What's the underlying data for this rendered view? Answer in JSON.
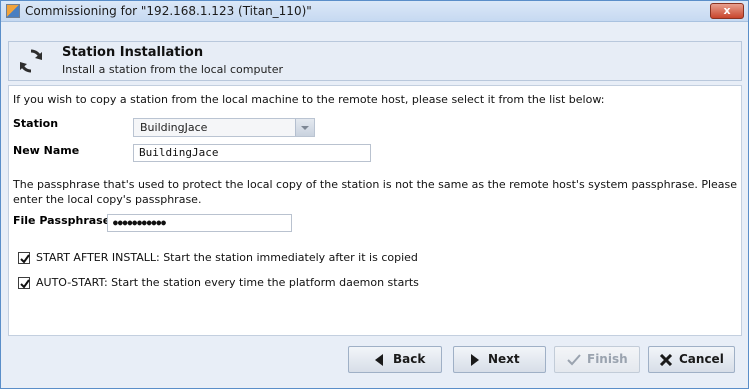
{
  "window": {
    "title": "Commissioning for \"192.168.1.123 (Titan_110)\"",
    "close_label": "x"
  },
  "header": {
    "title": "Station Installation",
    "subtitle": "Install a station from the local computer"
  },
  "form": {
    "intro": "If you wish to copy a station from the local machine to the remote host, please select it from the list below:",
    "station_label": "Station",
    "station_value": "BuildingJace",
    "new_name_label": "New Name",
    "new_name_value": "BuildingJace",
    "passphrase_note_line1": "The passphrase that's used to protect the local copy of the station is not the same as the remote host's system passphrase. Please",
    "passphrase_note_line2": "enter the local copy's passphrase.",
    "passphrase_label": "File Passphrase",
    "passphrase_value": "●●●●●●●●●●●",
    "start_after_install": {
      "checked": true,
      "label": "START AFTER INSTALL: Start the station immediately after it is copied"
    },
    "auto_start": {
      "checked": true,
      "label": "AUTO-START: Start the station every time the platform daemon starts"
    }
  },
  "buttons": {
    "back": "Back",
    "next": "Next",
    "finish": "Finish",
    "cancel": "Cancel"
  }
}
